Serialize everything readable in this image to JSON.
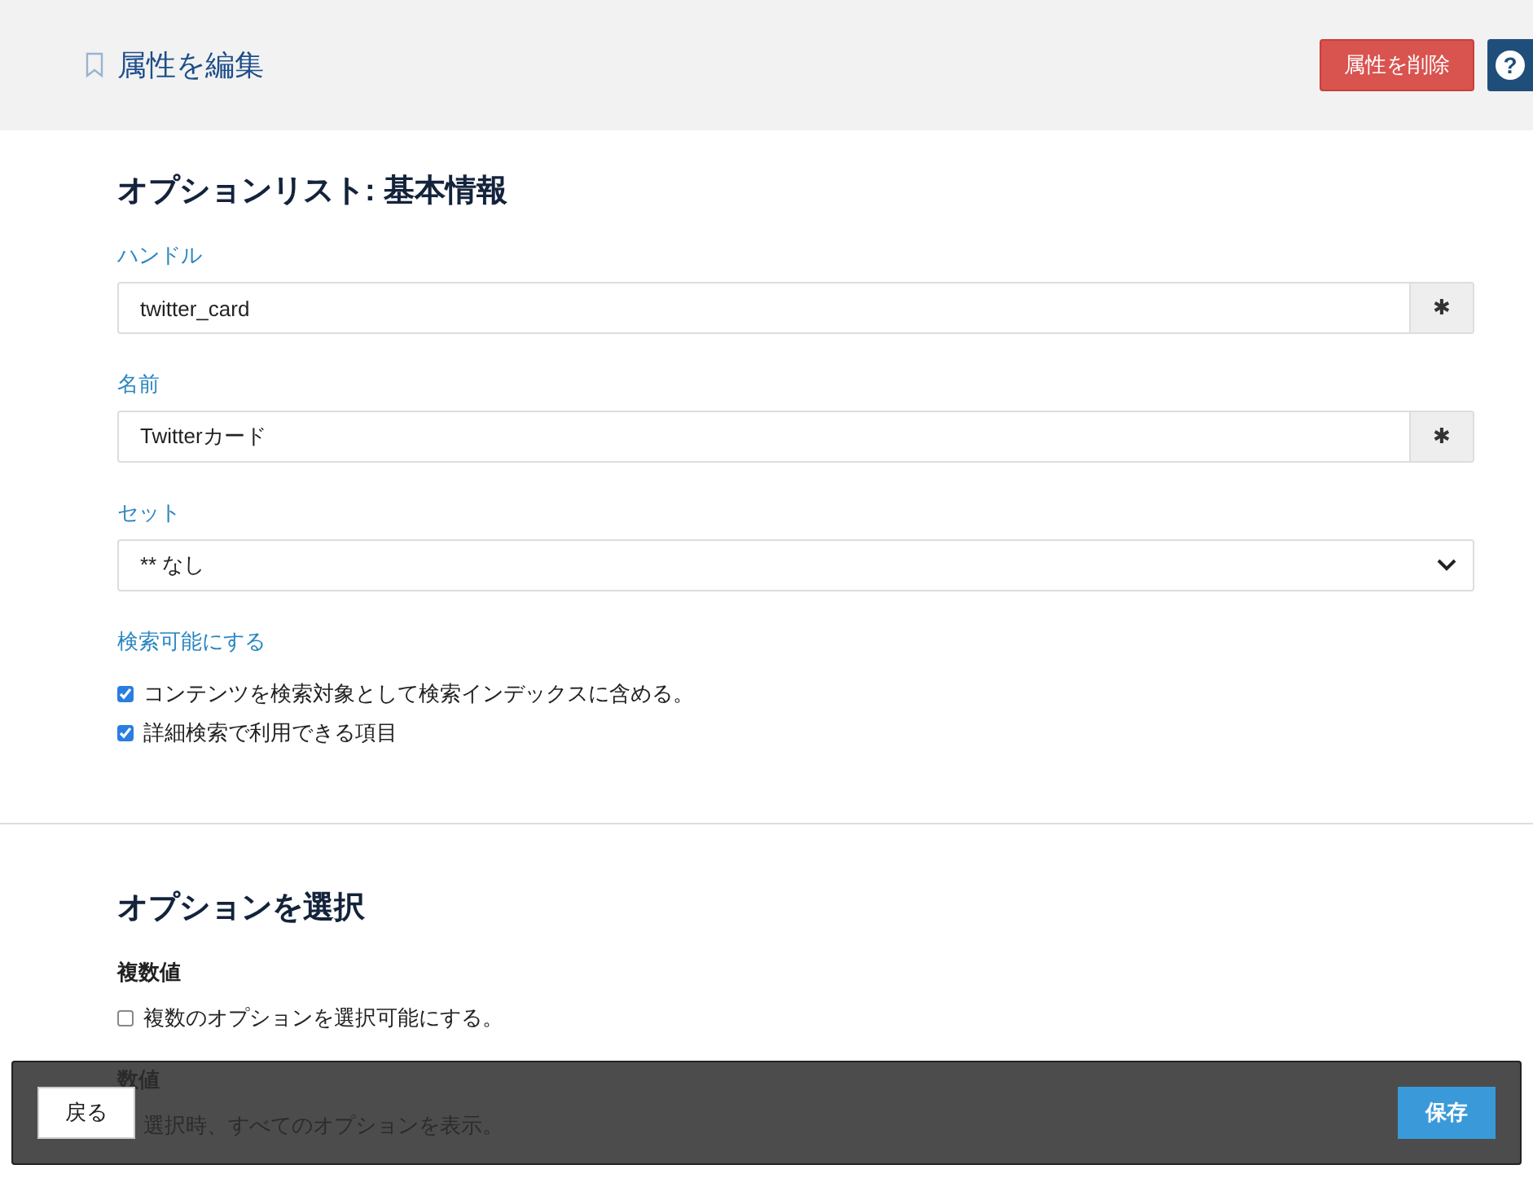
{
  "header": {
    "title": "属性を編集",
    "delete_button": "属性を削除",
    "help_button": "?"
  },
  "basic_section": {
    "title": "オプションリスト: 基本情報",
    "fields": [
      {
        "kind": "text",
        "label": "ハンドル",
        "value": "twitter_card",
        "required_mark": "✱"
      },
      {
        "kind": "text",
        "label": "名前",
        "value": "Twitterカード",
        "required_mark": "✱"
      },
      {
        "kind": "select",
        "label": "セット",
        "value": "** なし"
      }
    ],
    "search_label": "検索可能にする",
    "search_options": [
      {
        "label": "コンテンツを検索対象として検索インデックスに含める。",
        "checked": true
      },
      {
        "label": "詳細検索で利用できる項目",
        "checked": true
      }
    ]
  },
  "options_section": {
    "title": "オプションを選択",
    "groups": [
      {
        "heading": "複数値",
        "option": {
          "label": "複数のオプションを選択可能にする。",
          "checked": false
        }
      },
      {
        "heading": "数値",
        "option": {
          "label": "選択時、すべてのオプションを表示。"
        }
      }
    ]
  },
  "footer": {
    "back_button": "戻る",
    "save_button": "保存"
  }
}
